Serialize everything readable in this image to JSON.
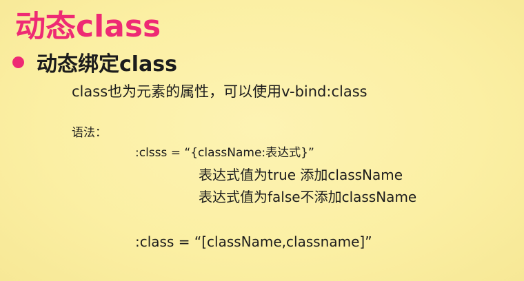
{
  "slide": {
    "title": "动态class",
    "bullet": "动态绑定class",
    "description": "class也为元素的属性，可以使用v-bind:class",
    "syntax_label": "语法：",
    "syntax_line1": ":clsss =   “{className:表达式}”",
    "note_true": "表达式值为true 添加className",
    "note_false": "表达式值为false不添加className",
    "syntax_line2": ":class =   “[className,classname]”"
  },
  "colors": {
    "background": "#fbf0a6",
    "accent": "#ee2a74",
    "text": "#1c1c1c"
  }
}
